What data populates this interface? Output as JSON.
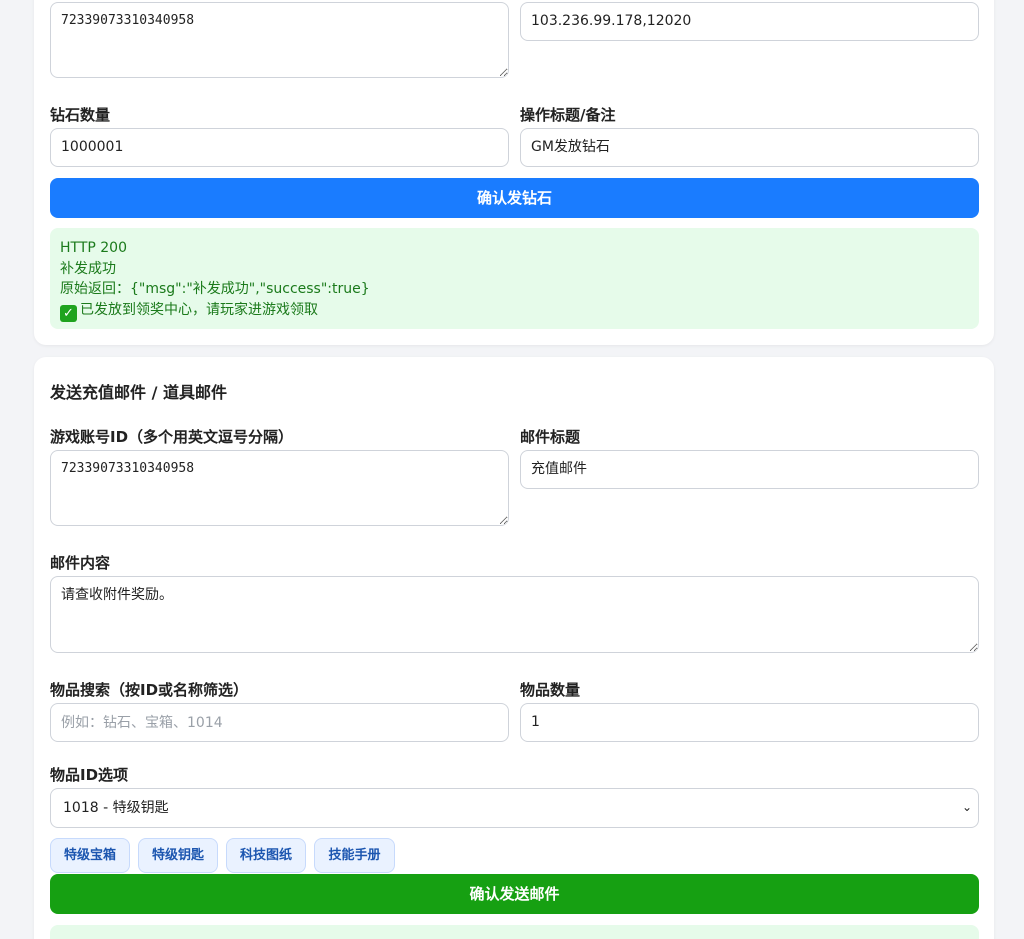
{
  "diamond_form": {
    "account_ids_value": "72339073310340958",
    "server_value": "103.236.99.178,12020",
    "diamond_count_label": "钻石数量",
    "diamond_count_value": "1000001",
    "op_title_label": "操作标题/备注",
    "op_title_value": "GM发放钻石",
    "confirm_button": "确认发钻石",
    "result": {
      "line1": "HTTP 200",
      "line2": "补发成功",
      "line3": "原始返回：{\"msg\":\"补发成功\",\"success\":true}",
      "line4": "已发放到领奖中心，请玩家进游戏领取",
      "check_icon": "check-mark-icon"
    }
  },
  "mail_form": {
    "section_title": "发送充值邮件 / 道具邮件",
    "account_ids_label": "游戏账号ID（多个用英文逗号分隔）",
    "account_ids_value": "72339073310340958",
    "mail_title_label": "邮件标题",
    "mail_title_value": "充值邮件",
    "mail_content_label": "邮件内容",
    "mail_content_value": "请查收附件奖励。",
    "item_search_label": "物品搜索（按ID或名称筛选）",
    "item_search_placeholder": "例如：钻石、宝箱、1014",
    "item_count_label": "物品数量",
    "item_count_value": "1",
    "item_id_label": "物品ID选项",
    "item_id_selected": "1018 - 特级钥匙",
    "chips": [
      "特级宝箱",
      "特级钥匙",
      "科技图纸",
      "技能手册"
    ],
    "confirm_button": "确认发送邮件"
  },
  "colors": {
    "primary": "#1a7cff",
    "success": "#16a012",
    "result_bg": "#e6fbea",
    "result_text": "#1b7a1b",
    "chip_bg": "#eaf2ff",
    "chip_text": "#1c56b0"
  }
}
